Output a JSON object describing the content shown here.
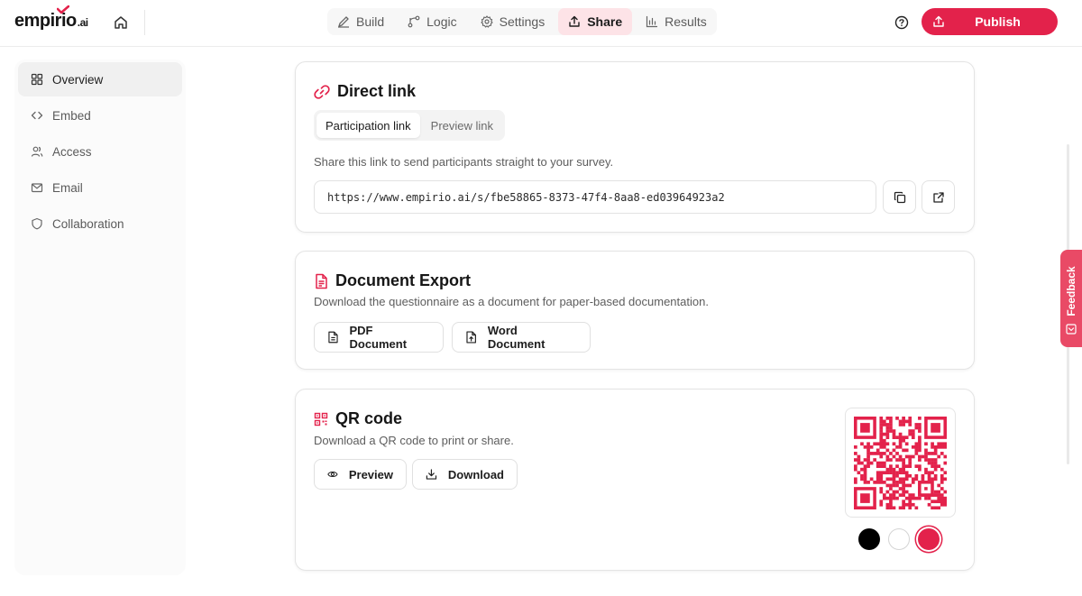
{
  "brand": {
    "logo_main": "empirio",
    "logo_tld": ".ai",
    "accent": "#e3224b"
  },
  "nav": {
    "tabs": [
      {
        "label": "Build",
        "icon": "pencil-icon"
      },
      {
        "label": "Logic",
        "icon": "branch-icon"
      },
      {
        "label": "Settings",
        "icon": "gear-icon"
      },
      {
        "label": "Share",
        "icon": "share-upload-icon",
        "active": true
      },
      {
        "label": "Results",
        "icon": "bar-chart-icon"
      }
    ],
    "publish_label": "Publish"
  },
  "sidebar": {
    "items": [
      {
        "label": "Overview",
        "icon": "grid-icon",
        "active": true
      },
      {
        "label": "Embed",
        "icon": "code-icon"
      },
      {
        "label": "Access",
        "icon": "users-icon"
      },
      {
        "label": "Email",
        "icon": "mail-icon"
      },
      {
        "label": "Collaboration",
        "icon": "shield-icon"
      }
    ]
  },
  "direct_link": {
    "title": "Direct link",
    "tabs": [
      "Participation link",
      "Preview link"
    ],
    "active_tab": "Participation link",
    "description": "Share this link to send participants straight to your survey.",
    "url": "https://www.empirio.ai/s/fbe58865-8373-47f4-8aa8-ed03964923a2"
  },
  "document_export": {
    "title": "Document Export",
    "description": "Download the questionnaire as a document for paper-based documentation.",
    "pdf_label": "PDF Document",
    "word_label": "Word Document"
  },
  "qr_code": {
    "title": "QR code",
    "description": "Download a QR code to print or share.",
    "preview_label": "Preview",
    "download_label": "Download",
    "qr_color": "#e3224b",
    "swatches": [
      "#000000",
      "#ffffff",
      "#e3224b"
    ],
    "selected_swatch": "#e3224b"
  },
  "feedback": {
    "label": "Feedback"
  }
}
